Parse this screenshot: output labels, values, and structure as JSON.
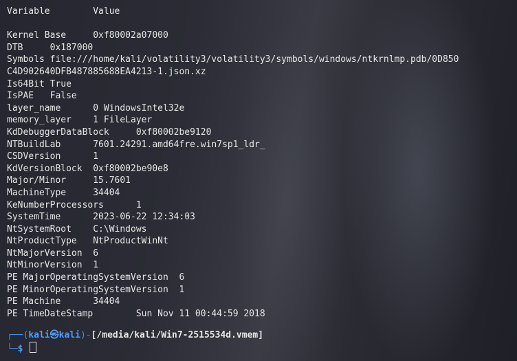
{
  "terminal": {
    "lines": [
      "Variable        Value",
      "",
      "Kernel Base     0xf80002a07000",
      "DTB     0x187000",
      "Symbols file:///home/kali/volatility3/volatility3/symbols/windows/ntkrnlmp.pdb/0D850",
      "C4D902640DFB487885688EA4213-1.json.xz",
      "Is64Bit True",
      "IsPAE   False",
      "layer_name      0 WindowsIntel32e",
      "memory_layer    1 FileLayer",
      "KdDebuggerDataBlock     0xf80002be9120",
      "NTBuildLab      7601.24291.amd64fre.win7sp1_ldr_",
      "CSDVersion      1",
      "KdVersionBlock  0xf80002be90e8",
      "Major/Minor     15.7601",
      "MachineType     34404",
      "KeNumberProcessors      1",
      "SystemTime      2023-06-22 12:34:03",
      "NtSystemRoot    C:\\Windows",
      "NtProductType   NtProductWinNt",
      "NtMajorVersion  6",
      "NtMinorVersion  1",
      "PE MajorOperatingSystemVersion  6",
      "PE MinorOperatingSystemVersion  1",
      "PE Machine      34404",
      "PE TimeDateStamp        Sun Nov 11 00:44:59 2018"
    ],
    "prompt": {
      "corner_top": "┌──",
      "open_paren": "(",
      "user": "kali",
      "skull": "㉿",
      "host": "kali",
      "close_paren": ")",
      "dash": "-",
      "path": "[/media/kali/Win7-2515534d.vmem]",
      "corner_bottom": "└─",
      "symbol": "$"
    }
  }
}
